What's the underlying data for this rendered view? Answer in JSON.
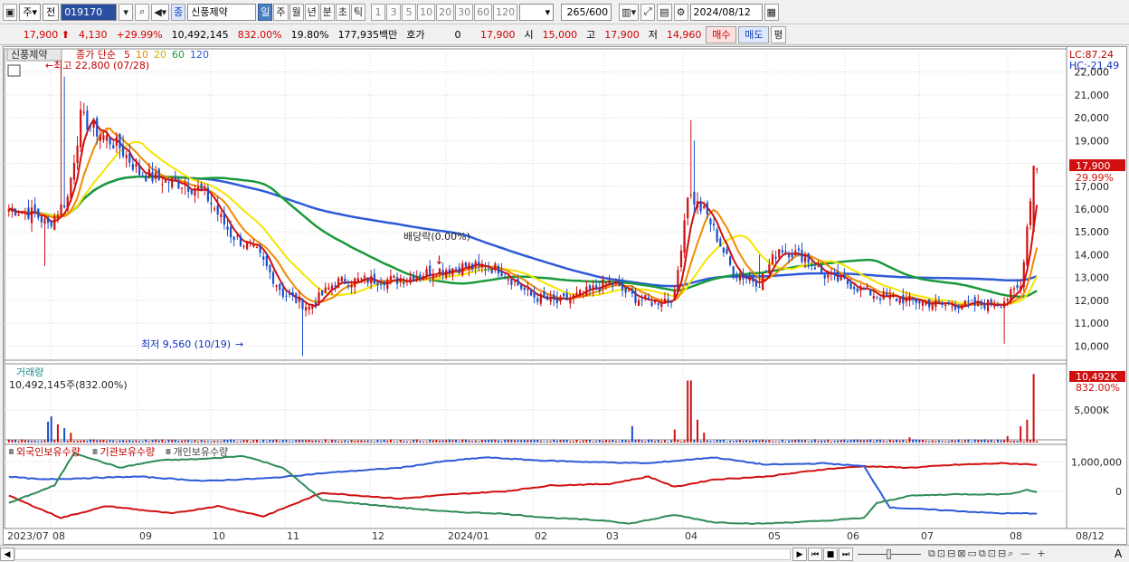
{
  "toolbar": {
    "market": "주",
    "period_label": "전",
    "code": "019170",
    "stock_name": "신풍제약",
    "jong_badge": "종",
    "periods": [
      "일",
      "주",
      "월",
      "년",
      "분",
      "초",
      "틱"
    ],
    "intervals": [
      "1",
      "3",
      "5",
      "10",
      "20",
      "30",
      "60",
      "120"
    ],
    "count": "265",
    "count_max": "/600",
    "date": "2024/08/12"
  },
  "quote": {
    "price": "17,900",
    "change": "4,130",
    "change_pct": "+29.99%",
    "volume": "10,492,145",
    "volume_ratio": "832.00%",
    "turnover": "19.80%",
    "amount": "177,935백만",
    "hoga_label": "호가",
    "hoga_value": "0",
    "hoga_price": "17,900",
    "open_label": "시",
    "open": "15,000",
    "high_label": "고",
    "high": "17,900",
    "low_label": "저",
    "low": "14,960",
    "buy_label": "매수",
    "sell_label": "매도",
    "eval_label": "평"
  },
  "colors": {
    "up": "#d01010",
    "down": "#1a4fcc",
    "ma5": "#d01010",
    "ma10": "#f08a00",
    "ma20": "#f5e400",
    "ma60": "#1a9a3a",
    "ma120": "#2d5ad8"
  },
  "chart_data": {
    "type": "candlestick",
    "title": "신풍제약",
    "legend": {
      "label": "종가 단순",
      "periods": [
        "5",
        "10",
        "20",
        "60",
        "120"
      ]
    },
    "y_ticks": [
      "22,000",
      "21,000",
      "20,000",
      "19,000",
      "18,000",
      "17,000",
      "16,000",
      "15,000",
      "14,000",
      "13,000",
      "12,000",
      "11,000",
      "10,000"
    ],
    "ylim": [
      9300,
      22700
    ],
    "x_labels": [
      "2023/07",
      "08",
      "09",
      "10",
      "11",
      "12",
      "2024/01",
      "02",
      "03",
      "04",
      "05",
      "06",
      "07",
      "08",
      "08/12"
    ],
    "lc": "LC:87.24",
    "hc": "HC:-21.49",
    "price_tag": "17,900",
    "price_tag_pct": "29.99%",
    "annotations": {
      "high": "최고 22,800 (07/28)",
      "low": "최저 9,560 (10/19)",
      "dividend": "배당락(0.00%)"
    },
    "close_anchors": [
      [
        0,
        16000
      ],
      [
        8,
        15800
      ],
      [
        12,
        15300
      ],
      [
        18,
        16500
      ],
      [
        22,
        20000
      ],
      [
        28,
        19300
      ],
      [
        34,
        18700
      ],
      [
        40,
        17600
      ],
      [
        46,
        17300
      ],
      [
        54,
        17100
      ],
      [
        60,
        16700
      ],
      [
        68,
        14900
      ],
      [
        76,
        14100
      ],
      [
        84,
        12300
      ],
      [
        92,
        11700
      ],
      [
        100,
        12800
      ],
      [
        110,
        12900
      ],
      [
        120,
        12900
      ],
      [
        130,
        13300
      ],
      [
        140,
        13500
      ],
      [
        150,
        13400
      ],
      [
        160,
        12200
      ],
      [
        168,
        11900
      ],
      [
        176,
        12300
      ],
      [
        184,
        12800
      ],
      [
        192,
        12100
      ],
      [
        198,
        11900
      ],
      [
        204,
        12200
      ],
      [
        208,
        16700
      ],
      [
        214,
        15700
      ],
      [
        222,
        13200
      ],
      [
        230,
        12800
      ],
      [
        236,
        14300
      ],
      [
        244,
        13900
      ],
      [
        250,
        13100
      ],
      [
        258,
        12700
      ],
      [
        266,
        12200
      ],
      [
        276,
        12000
      ],
      [
        286,
        11800
      ],
      [
        296,
        11800
      ],
      [
        304,
        11900
      ],
      [
        310,
        12600
      ],
      [
        314,
        17900
      ]
    ],
    "volume": {
      "label": "거래량",
      "value": "10,492,145주(832.00%)",
      "y_ticks": [
        "5,000K"
      ],
      "tag": "10,492K",
      "tag_pct": "832.00%",
      "spikes": [
        [
          12,
          3.2
        ],
        [
          13,
          4.0
        ],
        [
          15,
          2.8
        ],
        [
          17,
          2.2
        ],
        [
          19,
          1.5
        ],
        [
          208,
          9.5
        ],
        [
          209,
          9.5
        ],
        [
          211,
          3.5
        ],
        [
          213,
          1.5
        ],
        [
          204,
          2.0
        ],
        [
          191,
          2.5
        ],
        [
          276,
          0.8
        ],
        [
          306,
          1.0
        ],
        [
          310,
          2.5
        ],
        [
          312,
          3.5
        ],
        [
          314,
          10.49
        ]
      ]
    },
    "holdings": {
      "series_names": [
        "외국인보유수량",
        "기관보유수량",
        "개인보유수량"
      ],
      "y_ticks": [
        "1,000,000",
        "0"
      ],
      "ylim": [
        -1200000,
        1500000
      ],
      "foreign": [
        [
          0,
          -150000
        ],
        [
          16,
          -900000
        ],
        [
          30,
          -500000
        ],
        [
          50,
          -750000
        ],
        [
          64,
          -500000
        ],
        [
          78,
          -850000
        ],
        [
          96,
          -50000
        ],
        [
          120,
          -250000
        ],
        [
          136,
          -100000
        ],
        [
          152,
          0
        ],
        [
          166,
          200000
        ],
        [
          184,
          250000
        ],
        [
          196,
          500000
        ],
        [
          204,
          150000
        ],
        [
          216,
          400000
        ],
        [
          232,
          500000
        ],
        [
          250,
          750000
        ],
        [
          262,
          850000
        ],
        [
          276,
          800000
        ],
        [
          290,
          900000
        ],
        [
          304,
          950000
        ],
        [
          316,
          900000
        ]
      ],
      "institution": [
        [
          0,
          500000
        ],
        [
          10,
          400000
        ],
        [
          24,
          450000
        ],
        [
          40,
          500000
        ],
        [
          60,
          350000
        ],
        [
          80,
          450000
        ],
        [
          100,
          650000
        ],
        [
          120,
          800000
        ],
        [
          132,
          1000000
        ],
        [
          146,
          1150000
        ],
        [
          162,
          1050000
        ],
        [
          176,
          1000000
        ],
        [
          196,
          950000
        ],
        [
          216,
          1150000
        ],
        [
          232,
          900000
        ],
        [
          250,
          950000
        ],
        [
          262,
          850000
        ],
        [
          270,
          -550000
        ],
        [
          288,
          -650000
        ],
        [
          304,
          -750000
        ],
        [
          316,
          -750000
        ]
      ],
      "individual": [
        [
          0,
          -400000
        ],
        [
          14,
          200000
        ],
        [
          20,
          1300000
        ],
        [
          34,
          800000
        ],
        [
          46,
          1050000
        ],
        [
          60,
          1100000
        ],
        [
          72,
          1200000
        ],
        [
          84,
          800000
        ],
        [
          96,
          -300000
        ],
        [
          120,
          -550000
        ],
        [
          136,
          -700000
        ],
        [
          150,
          -750000
        ],
        [
          166,
          -900000
        ],
        [
          184,
          -1000000
        ],
        [
          190,
          -1100000
        ],
        [
          204,
          -800000
        ],
        [
          216,
          -1050000
        ],
        [
          230,
          -1100000
        ],
        [
          250,
          -1000000
        ],
        [
          262,
          -900000
        ],
        [
          266,
          -400000
        ],
        [
          276,
          -150000
        ],
        [
          290,
          -100000
        ],
        [
          306,
          -100000
        ],
        [
          312,
          50000
        ],
        [
          316,
          -50000
        ]
      ]
    }
  }
}
